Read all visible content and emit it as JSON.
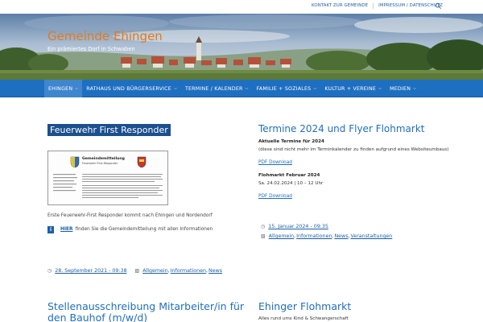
{
  "topbar": {
    "links": [
      "KONTAKT ZUR GEMEINDE",
      "IMPRESSUM / DATENSCHUTZ"
    ],
    "search_icon": "search-icon"
  },
  "site": {
    "title": "Gemeinde Ehingen",
    "tagline": "Ein prämiertes Dorf in Schwaben"
  },
  "nav": {
    "items": [
      {
        "label": "EHINGEN",
        "active": true
      },
      {
        "label": "RATHAUS UND BÜRGERSERVICE",
        "active": false
      },
      {
        "label": "TERMINE / KALENDER",
        "active": false
      },
      {
        "label": "FAMILIE + SOZIALES",
        "active": false
      },
      {
        "label": "KULTUR + VEREINE",
        "active": false
      },
      {
        "label": "MEDIEN",
        "active": false
      }
    ],
    "chevron": "chevron-down-icon"
  },
  "post1": {
    "title": "Feuerwehr First Responder",
    "notice_heading": "Gemeindemitteilung",
    "notice_sub": "Feuerwehr First-Responder",
    "caption": "Erste Feuerwehr-First Responder kommt nach Ehingen und Nordendorf",
    "info_link": "HIER",
    "info_text": "finden Sie die Gemeindemitteilung mit allen Informationen",
    "date": "28. September 2021 - 09:38",
    "categories": [
      "Allgemein",
      "Informationen",
      "News"
    ]
  },
  "post2": {
    "title": "Termine 2024 und Flyer Flohmarkt",
    "block1_head": "Aktuelle Termine für 2024",
    "block1_note": "(diese sind nicht mehr im Terminkalender zu finden aufgrund eines Websiteumbaus)",
    "pdf1": "PDF Download",
    "block2_head": "Flohmarkt Februar 2024",
    "block2_date": "Sa. 24.02.2024 | 10 – 12 Uhr",
    "pdf2": "PDF Download",
    "date": "15. Januar 2024 - 09:35",
    "categories": [
      "Allgemein",
      "Informationen",
      "News",
      "Veranstaltungen"
    ]
  },
  "bottom": {
    "left_title": "Stellenausschreibung Mitarbeiter/in für den Bauhof (m/w/d)",
    "right_title": "Ehinger Flohmarkt",
    "right_sub": "Alles rund ums Kind & Schwangerschaft"
  },
  "colors": {
    "nav_bg": "#1f6fc0",
    "nav_active": "#3f86cf",
    "title_orange": "#e47a1a",
    "link_blue": "#1f6fc0",
    "title_box": "#1b4f8d"
  }
}
